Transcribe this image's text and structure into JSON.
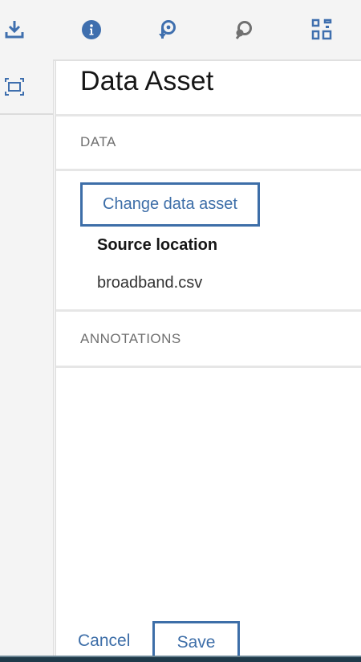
{
  "colors": {
    "accent": "#3d6ea8",
    "icon_blue": "#3f6fae",
    "icon_gray": "#707070",
    "rail_bg": "#f4f4f4"
  },
  "toolbar": {
    "icons": [
      "download-icon",
      "info-icon",
      "rotate-left-icon",
      "rotate-right-icon",
      "qr-grid-icon"
    ]
  },
  "rail": {
    "icons": [
      "fit-to-screen-icon"
    ]
  },
  "panel": {
    "title": "Data Asset",
    "data_section_label": "DATA",
    "change_button_label": "Change data asset",
    "source_location_label": "Source location",
    "source_location_value": "broadband.csv",
    "annotations_section_label": "ANNOTATIONS"
  },
  "footer": {
    "cancel_label": "Cancel",
    "save_label": "Save"
  }
}
